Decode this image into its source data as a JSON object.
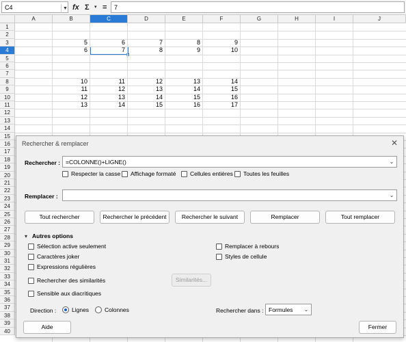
{
  "formula_bar": {
    "name_box": "C4",
    "dropdown_icon": "chevron-down-icon",
    "fx_label": "fx",
    "sigma_label": "Σ",
    "sigma_arrow": "▾",
    "equals_label": "=",
    "formula": "7"
  },
  "columns": [
    "A",
    "B",
    "C",
    "D",
    "E",
    "F",
    "G",
    "H",
    "I",
    "J"
  ],
  "selected_column": "C",
  "rows": [
    "1",
    "2",
    "3",
    "4",
    "5",
    "6",
    "7",
    "8",
    "9",
    "10",
    "11",
    "12",
    "13",
    "14",
    "15",
    "16",
    "17",
    "18",
    "19",
    "20",
    "21",
    "22",
    "23",
    "24",
    "25",
    "26",
    "27",
    "28",
    "29",
    "30",
    "31",
    "32",
    "33",
    "34",
    "35",
    "36",
    "37",
    "38",
    "39",
    "40"
  ],
  "selected_row": "4",
  "cells": {
    "row3": [
      "5",
      "6",
      "7",
      "8",
      "9"
    ],
    "row4": [
      "6",
      "7",
      "8",
      "9",
      "10"
    ],
    "row8": [
      "10",
      "11",
      "12",
      "13",
      "14"
    ],
    "row9": [
      "11",
      "12",
      "13",
      "14",
      "15"
    ],
    "row10": [
      "12",
      "13",
      "14",
      "15",
      "16"
    ],
    "row11": [
      "13",
      "14",
      "15",
      "16",
      "17"
    ]
  },
  "dialog": {
    "title": "Rechercher & remplacer",
    "close_icon": "close-icon",
    "search_label": "Rechercher :",
    "search_value": "=COLONNE()+LIGNE()",
    "opt_match_case": "Respecter la casse",
    "opt_formatted": "Affichage formaté",
    "opt_entire_cells": "Cellules entières",
    "opt_all_sheets": "Toutes les feuilles",
    "replace_label": "Remplacer :",
    "replace_value": "",
    "btn_find_all": "Tout rechercher",
    "btn_find_prev": "Rechercher le précédent",
    "btn_find_next": "Rechercher le suivant",
    "btn_replace": "Remplacer",
    "btn_replace_all": "Tout remplacer",
    "other_options": "Autres options",
    "opt_current_selection": "Sélection active seulement",
    "opt_wildcards": "Caractères joker",
    "opt_regex": "Expressions régulières",
    "opt_similarity": "Rechercher des similarités",
    "btn_similarities": "Similarités...",
    "opt_diacritics": "Sensible aux diacritiques",
    "opt_backwards": "Remplacer à rebours",
    "opt_cell_styles": "Styles de cellule",
    "direction_label": "Direction :",
    "dir_rows": "Lignes",
    "dir_columns": "Colonnes",
    "search_in_label": "Rechercher dans :",
    "search_in_value": "Formules",
    "btn_help": "Aide",
    "btn_close": "Fermer"
  }
}
